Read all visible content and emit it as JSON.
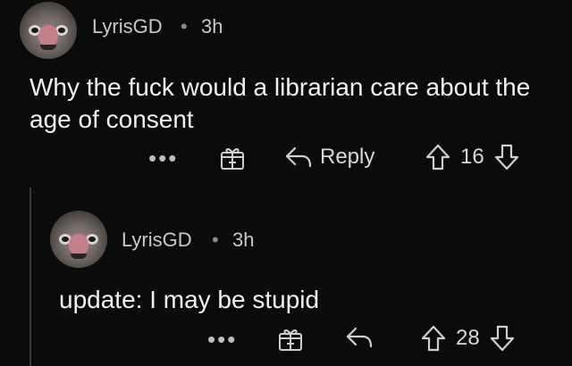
{
  "comments": [
    {
      "username": "LyrisGD",
      "separator": "•",
      "time": "3h",
      "text": "Why the fuck would a librarian care about the age of consent",
      "actions": {
        "more": "•••",
        "reply_label": "Reply",
        "votes": "16"
      }
    },
    {
      "username": "LyrisGD",
      "separator": "•",
      "time": "3h",
      "text": "update: I may be stupid",
      "actions": {
        "more": "•••",
        "reply_label": "",
        "votes": "28"
      }
    }
  ],
  "icons": {
    "gift": "gift-icon",
    "reply": "reply-arrow-icon",
    "upvote": "upvote-arrow-icon",
    "downvote": "downvote-arrow-icon"
  }
}
